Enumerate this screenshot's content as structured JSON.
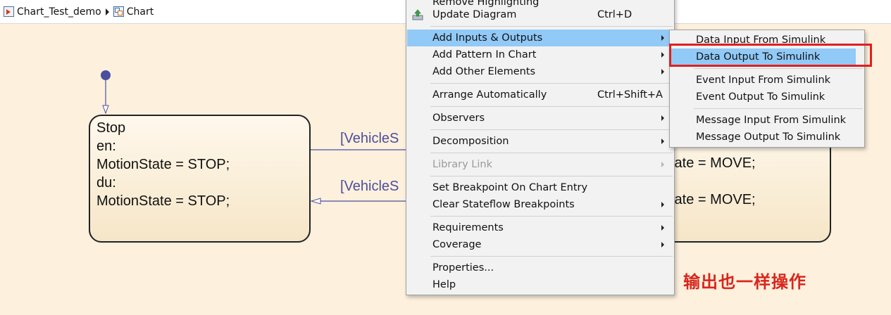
{
  "breadcrumb": {
    "model_label": "Chart_Test_demo",
    "chart_label": "Chart"
  },
  "diagram": {
    "stop_state": {
      "lines": [
        "Stop",
        "en:",
        "MotionState = STOP;",
        "du:",
        "MotionState = STOP;"
      ]
    },
    "move_state": {
      "line_1": "tate = MOVE;",
      "line_2": "tate = MOVE;"
    },
    "transition_top_label": "[VehicleS",
    "transition_bottom_label": "[VehicleS",
    "annotation": "输出也一样操作"
  },
  "context_menu": {
    "items": [
      {
        "label": "Remove Highlighting",
        "shortcut": "",
        "submenu": false,
        "disabled": false
      },
      {
        "label": "Update Diagram",
        "shortcut": "Ctrl+D",
        "submenu": false,
        "disabled": false,
        "icon": "update-diagram-icon"
      },
      {
        "label": "Add Inputs & Outputs",
        "shortcut": "",
        "submenu": true,
        "disabled": false,
        "highlighted": true
      },
      {
        "label": "Add Pattern In Chart",
        "shortcut": "",
        "submenu": true,
        "disabled": false
      },
      {
        "label": "Add Other Elements",
        "shortcut": "",
        "submenu": true,
        "disabled": false
      },
      {
        "label": "Arrange Automatically",
        "shortcut": "Ctrl+Shift+A",
        "submenu": false,
        "disabled": false
      },
      {
        "label": "Observers",
        "shortcut": "",
        "submenu": true,
        "disabled": false
      },
      {
        "label": "Decomposition",
        "shortcut": "",
        "submenu": true,
        "disabled": false
      },
      {
        "label": "Library Link",
        "shortcut": "",
        "submenu": true,
        "disabled": true
      },
      {
        "label": "Set Breakpoint On Chart Entry",
        "shortcut": "",
        "submenu": false,
        "disabled": false
      },
      {
        "label": "Clear Stateflow Breakpoints",
        "shortcut": "",
        "submenu": true,
        "disabled": false
      },
      {
        "label": "Requirements",
        "shortcut": "",
        "submenu": true,
        "disabled": false
      },
      {
        "label": "Coverage",
        "shortcut": "",
        "submenu": true,
        "disabled": false
      },
      {
        "label": "Properties...",
        "shortcut": "",
        "submenu": false,
        "disabled": false
      },
      {
        "label": "Help",
        "shortcut": "",
        "submenu": false,
        "disabled": false
      }
    ]
  },
  "submenu": {
    "items": [
      {
        "label": "Data Input From Simulink"
      },
      {
        "label": "Data Output To Simulink",
        "highlighted": true
      },
      {
        "label": "Event Input From Simulink"
      },
      {
        "label": "Event Output To Simulink"
      },
      {
        "label": "Message Input From Simulink"
      },
      {
        "label": "Message Output To Simulink"
      }
    ]
  },
  "colors": {
    "canvas": "#fdf0dd",
    "menu_highlight": "#91c9f7",
    "annotation_red": "#d8261d",
    "transition_blue": "#4c4f9c"
  }
}
